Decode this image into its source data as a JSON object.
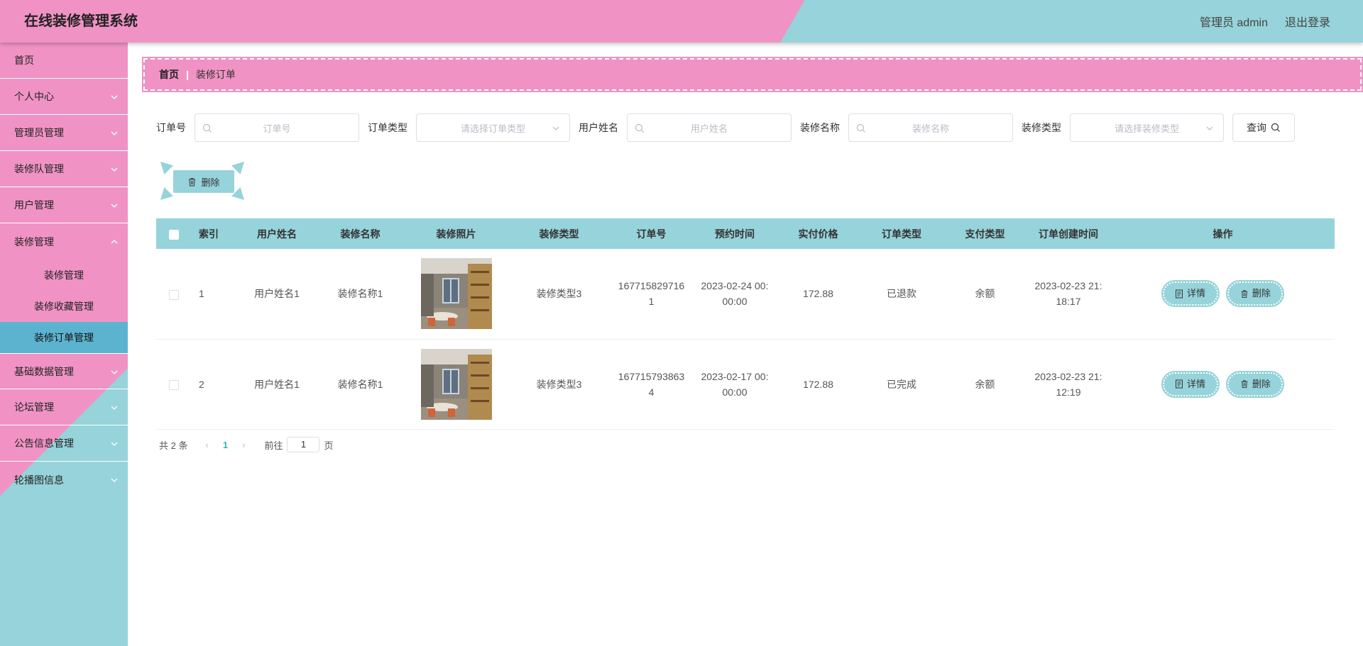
{
  "header": {
    "title": "在线装修管理系统",
    "admin": "管理员 admin",
    "logout": "退出登录"
  },
  "sidebar": {
    "items": [
      {
        "label": "首页"
      },
      {
        "label": "个人中心"
      },
      {
        "label": "管理员管理"
      },
      {
        "label": "装修队管理"
      },
      {
        "label": "用户管理"
      },
      {
        "label": "装修管理"
      }
    ],
    "sub_items": [
      {
        "label": "装修管理"
      },
      {
        "label": "装修收藏管理"
      },
      {
        "label": "装修订单管理"
      }
    ],
    "items_after": [
      {
        "label": "基础数据管理"
      },
      {
        "label": "论坛管理"
      },
      {
        "label": "公告信息管理"
      },
      {
        "label": "轮播图信息"
      }
    ]
  },
  "breadcrumb": {
    "home": "首页",
    "separator": "|",
    "current": "装修订单"
  },
  "search": {
    "order_no_label": "订单号",
    "order_no_placeholder": "订单号",
    "order_type_label": "订单类型",
    "order_type_placeholder": "请选择订单类型",
    "user_name_label": "用户姓名",
    "user_name_placeholder": "用户姓名",
    "deco_name_label": "装修名称",
    "deco_name_placeholder": "装修名称",
    "deco_type_label": "装修类型",
    "deco_type_placeholder": "请选择装修类型",
    "query_label": "查询"
  },
  "toolbar": {
    "delete_label": "删除"
  },
  "table": {
    "columns": [
      "索引",
      "用户姓名",
      "装修名称",
      "装修照片",
      "装修类型",
      "订单号",
      "预约时间",
      "实付价格",
      "订单类型",
      "支付类型",
      "订单创建时间",
      "操作"
    ],
    "rows": [
      {
        "index": "1",
        "user": "用户姓名1",
        "deco_name": "装修名称1",
        "deco_type": "装修类型3",
        "order_no": "1677158297161",
        "appoint_time": "2023-02-24 00:00:00",
        "price": "172.88",
        "order_type": "已退款",
        "pay_type": "余额",
        "created": "2023-02-23 21:18:17",
        "detail": "详情",
        "delete": "删除"
      },
      {
        "index": "2",
        "user": "用户姓名1",
        "deco_name": "装修名称1",
        "deco_type": "装修类型3",
        "order_no": "1677157938634",
        "appoint_time": "2023-02-17 00:00:00",
        "price": "172.88",
        "order_type": "已完成",
        "pay_type": "余额",
        "created": "2023-02-23 21:12:19",
        "detail": "详情",
        "delete": "删除"
      }
    ]
  },
  "pagination": {
    "total": "共 2 条",
    "current": "1",
    "goto_label": "前往",
    "goto_value": "1",
    "unit": "页"
  },
  "colors": {
    "pink": "#f093c4",
    "teal": "#96d3da",
    "active": "#5cb3d0"
  }
}
